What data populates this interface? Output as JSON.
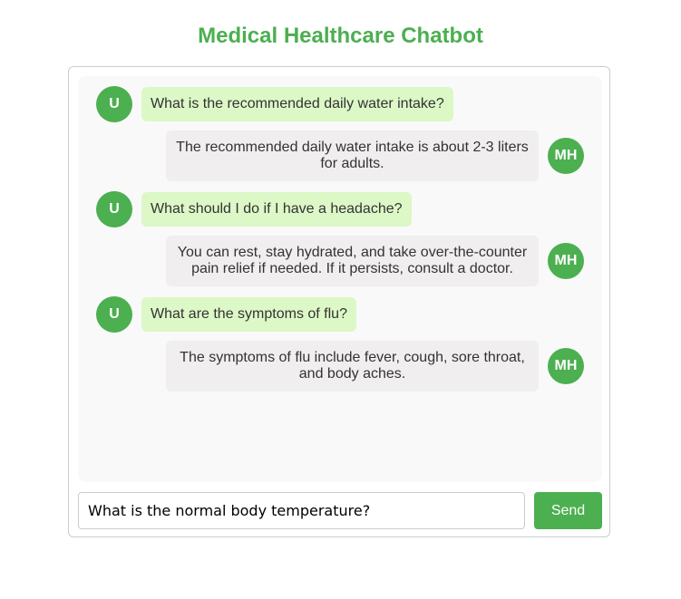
{
  "app": {
    "title": "Medical Healthcare Chatbot",
    "accent_color": "#4caf50",
    "user_bubble_color": "#dcf8c6",
    "bot_bubble_color": "#f0eeee"
  },
  "messages": [
    {
      "sender": "user",
      "avatar": "U",
      "text": "What is the recommended daily water intake?"
    },
    {
      "sender": "bot",
      "avatar": "MH",
      "text": "The recommended daily water intake is about 2-3 liters for adults."
    },
    {
      "sender": "user",
      "avatar": "U",
      "text": "What should I do if I have a headache?"
    },
    {
      "sender": "bot",
      "avatar": "MH",
      "text": "You can rest, stay hydrated, and take over-the-counter pain relief if needed. If it persists, consult a doctor."
    },
    {
      "sender": "user",
      "avatar": "U",
      "text": "What are the symptoms of flu?"
    },
    {
      "sender": "bot",
      "avatar": "MH",
      "text": "The symptoms of flu include fever, cough, sore throat, and body aches."
    }
  ],
  "input": {
    "value": "What is the normal body temperature?"
  },
  "send_label": "Send"
}
